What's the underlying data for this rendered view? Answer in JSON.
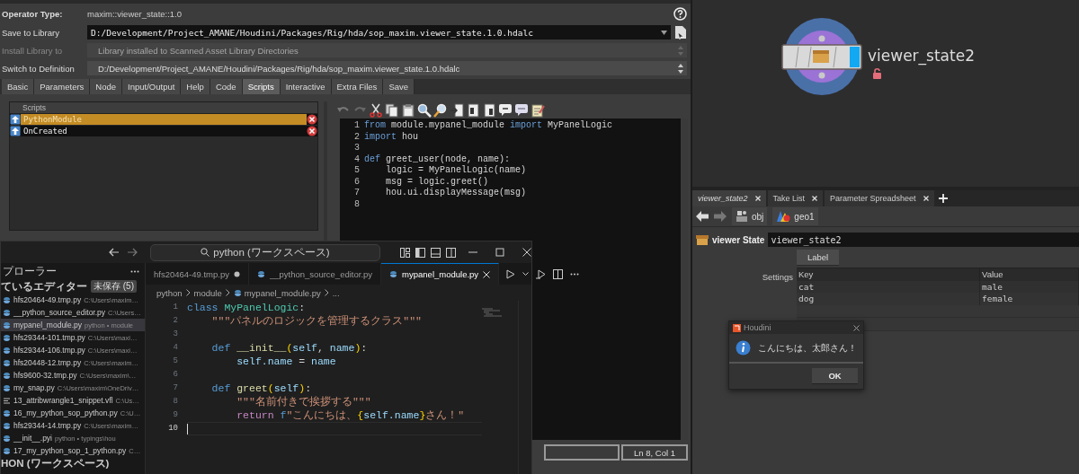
{
  "houdini": {
    "operator_type": {
      "label": "Operator Type:",
      "value": "maxim::viewer_state::1.0"
    },
    "fields": [
      {
        "label": "Save to Library",
        "value": "D:/Development/Project_AMANE/Houdini/Packages/Rig/hda/sop_maxim.viewer_state.1.0.hdalc",
        "kind": "combo",
        "disabled": false
      },
      {
        "label": "Install Library to",
        "value": "Library installed to Scanned Asset Library Directories",
        "kind": "menu",
        "disabled": true
      },
      {
        "label": "Switch to Definition",
        "value": "D:/Development/Project_AMANE/Houdini/Packages/Rig/hda/sop_maxim.viewer_state.1.0.hdalc",
        "kind": "menu",
        "disabled": false
      }
    ],
    "tabs": [
      {
        "label": "Basic",
        "selected": false
      },
      {
        "label": "Parameters",
        "selected": false
      },
      {
        "label": "Node",
        "selected": false
      },
      {
        "label": "Input/Output",
        "selected": false
      },
      {
        "label": "Help",
        "selected": false
      },
      {
        "label": "Code",
        "selected": false
      },
      {
        "label": "Scripts",
        "selected": true
      },
      {
        "label": "Interactive",
        "selected": false
      },
      {
        "label": "Extra Files",
        "selected": false
      },
      {
        "label": "Save",
        "selected": false
      }
    ],
    "scripts": {
      "header": "Scripts",
      "items": [
        {
          "name": "PythonModule",
          "selected": true
        },
        {
          "name": "OnCreated",
          "selected": false
        }
      ]
    },
    "editor": {
      "lines": [
        {
          "number": "1",
          "tokens": [
            {
              "kind": "kw",
              "text": "from"
            },
            {
              "kind": "plain",
              "text": " module.mypanel_module "
            },
            {
              "kind": "kw",
              "text": "import"
            },
            {
              "kind": "plain",
              "text": " MyPanelLogic"
            }
          ]
        },
        {
          "number": "2",
          "tokens": [
            {
              "kind": "kw",
              "text": "import"
            },
            {
              "kind": "plain",
              "text": " hou"
            }
          ]
        },
        {
          "number": "3"
        },
        {
          "number": "4",
          "tokens": [
            {
              "kind": "kw",
              "text": "def"
            },
            {
              "kind": "plain",
              "text": " greet_user(node, name):"
            }
          ]
        },
        {
          "number": "5",
          "tokens": [
            {
              "kind": "plain",
              "text": "    logic = MyPanelLogic(name)"
            }
          ]
        },
        {
          "number": "6",
          "tokens": [
            {
              "kind": "plain",
              "text": "    msg = logic.greet()"
            }
          ]
        },
        {
          "number": "7",
          "tokens": [
            {
              "kind": "plain",
              "text": "    hou.ui.displayMessage(msg)"
            }
          ]
        },
        {
          "number": "8"
        }
      ]
    },
    "status_bar": {
      "position": "Ln 8, Col 1"
    }
  },
  "network": {
    "node": {
      "name": "viewer_state2"
    }
  },
  "pane_tabs": [
    {
      "label": "viewer_state2",
      "selected": true
    },
    {
      "label": "Take List",
      "selected": false
    },
    {
      "label": "Parameter Spreadsheet",
      "selected": false
    }
  ],
  "path_bar": {
    "items": [
      {
        "label": "obj",
        "kind": "network"
      },
      {
        "label": "geo1",
        "kind": "geometry"
      }
    ]
  },
  "parameters": {
    "node_type": "viewer State",
    "node_name": "viewer_state2",
    "label_button": "Label",
    "settings_label": "Settings",
    "table": {
      "columns": [
        "Key",
        "Value"
      ],
      "rows": [
        [
          "cat",
          "male"
        ],
        [
          "dog",
          "female"
        ]
      ]
    }
  },
  "dialog": {
    "title": "Houdini",
    "message": "こんにちは、太郎さん！",
    "button": "OK"
  },
  "vscode": {
    "search": "python (ワークスペース)",
    "explorer_title": "プローラー",
    "open_editors": {
      "title": "ているエディター",
      "badge": "未保存 (5)"
    },
    "files": [
      {
        "name": "hfs20464-49.tmp.py",
        "detail": "C:\\Users\\maxim…",
        "kind": "python",
        "selected": false
      },
      {
        "name": "__python_source_editor.py",
        "detail": "C:\\Users…",
        "kind": "python",
        "selected": false
      },
      {
        "name": "mypanel_module.py",
        "detail": "python • module",
        "kind": "python",
        "selected": true
      },
      {
        "name": "hfs29344-101.tmp.py",
        "detail": "C:\\Users\\maxi…",
        "kind": "python",
        "selected": false
      },
      {
        "name": "hfs29344-106.tmp.py",
        "detail": "C:\\Users\\maxi…",
        "kind": "python",
        "selected": false
      },
      {
        "name": "hfs20448-12.tmp.py",
        "detail": "C:\\Users\\maxim…",
        "kind": "python",
        "selected": false
      },
      {
        "name": "hfs9600-32.tmp.py",
        "detail": "C:\\Users\\maxim\\…",
        "kind": "python",
        "selected": false
      },
      {
        "name": "my_snap.py",
        "detail": "C:\\Users\\maxim\\OneDriv…",
        "kind": "python",
        "selected": false
      },
      {
        "name": "13_attribwrangle1_snippet.vfl",
        "detail": "C:\\Us…",
        "kind": "text",
        "selected": false
      },
      {
        "name": "16_my_python_sop_python.py",
        "detail": "C:\\U…",
        "kind": "python",
        "selected": false
      },
      {
        "name": "hfs29344-14.tmp.py",
        "detail": "C:\\Users\\maxim…",
        "kind": "python",
        "selected": false
      },
      {
        "name": "__init__.pyi",
        "detail": "python • typings\\hou",
        "kind": "python",
        "selected": false
      },
      {
        "name": "17_my_python_sop_1_python.py",
        "detail": "C…",
        "kind": "python",
        "selected": false
      }
    ],
    "workspace_section": "HON (ワークスペース)",
    "tabs": [
      {
        "label": "hfs20464-49.tmp.py",
        "kind": "plain",
        "selected": false,
        "modified": true
      },
      {
        "label": "__python_source_editor.py",
        "kind": "python",
        "selected": false,
        "modified": false
      },
      {
        "label": "mypanel_module.py",
        "kind": "python",
        "selected": true,
        "modified": false
      }
    ],
    "breadcrumb": [
      "python",
      "module",
      "mypanel_module.py",
      "..."
    ],
    "lines": [
      {
        "number": "1",
        "current": false,
        "tokens": [
          {
            "kind": "kw",
            "text": "class"
          },
          {
            "kind": "cls",
            "text": " MyPanelLogic"
          },
          {
            "kind": "plain",
            "text": ":"
          }
        ]
      },
      {
        "number": "2",
        "current": false,
        "tokens": [
          {
            "kind": "str",
            "text": "    \"\"\"パネルのロジックを管理するクラス\"\"\""
          }
        ]
      },
      {
        "number": "3",
        "current": false
      },
      {
        "number": "4",
        "current": false,
        "tokens": [
          {
            "kind": "kw",
            "text": "    def"
          },
          {
            "kind": "fn",
            "text": " __init__"
          },
          {
            "kind": "brace",
            "text": "("
          },
          {
            "kind": "param",
            "text": "self"
          },
          {
            "kind": "plain",
            "text": ", "
          },
          {
            "kind": "param",
            "text": "name"
          },
          {
            "kind": "brace",
            "text": ")"
          },
          {
            "kind": "plain",
            "text": ":"
          }
        ]
      },
      {
        "number": "5",
        "current": false,
        "tokens": [
          {
            "kind": "param",
            "text": "        self.name"
          },
          {
            "kind": "plain",
            "text": " = "
          },
          {
            "kind": "param",
            "text": "name"
          }
        ]
      },
      {
        "number": "6",
        "current": false
      },
      {
        "number": "7",
        "current": false,
        "tokens": [
          {
            "kind": "kw",
            "text": "    def"
          },
          {
            "kind": "fn",
            "text": " greet"
          },
          {
            "kind": "brace",
            "text": "("
          },
          {
            "kind": "param",
            "text": "self"
          },
          {
            "kind": "brace",
            "text": ")"
          },
          {
            "kind": "plain",
            "text": ":"
          }
        ]
      },
      {
        "number": "8",
        "current": false,
        "tokens": [
          {
            "kind": "str",
            "text": "        \"\"\"名前付きで挨拶する\"\"\""
          }
        ]
      },
      {
        "number": "9",
        "current": false,
        "tokens": [
          {
            "kind": "ctl",
            "text": "        return"
          },
          {
            "kind": "kw",
            "text": " f"
          },
          {
            "kind": "str",
            "text": "\"こんにちは、"
          },
          {
            "kind": "brace",
            "text": "{"
          },
          {
            "kind": "param",
            "text": "self.name"
          },
          {
            "kind": "brace",
            "text": "}"
          },
          {
            "kind": "str",
            "text": "さん！\""
          }
        ]
      },
      {
        "number": "10",
        "current": true
      }
    ]
  }
}
